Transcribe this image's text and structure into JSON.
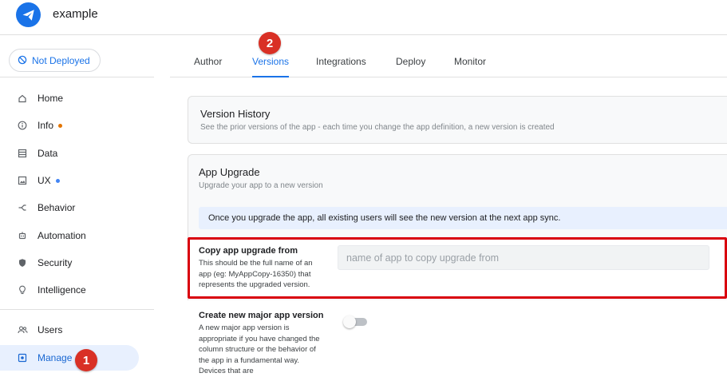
{
  "app": {
    "name": "example",
    "logo_icon": "paper-plane-icon",
    "brand_color": "#1a73e8"
  },
  "status": {
    "label": "Not Deployed",
    "icon": "not-deployed-icon"
  },
  "sidebar": {
    "items": [
      {
        "label": "Home",
        "icon": "home-icon"
      },
      {
        "label": "Info",
        "icon": "info-icon",
        "dot_color": "#e37400"
      },
      {
        "label": "Data",
        "icon": "data-icon"
      },
      {
        "label": "UX",
        "icon": "ux-icon",
        "dot_color": "#4285f4"
      },
      {
        "label": "Behavior",
        "icon": "behavior-icon"
      },
      {
        "label": "Automation",
        "icon": "automation-icon"
      },
      {
        "label": "Security",
        "icon": "shield-icon"
      },
      {
        "label": "Intelligence",
        "icon": "lightbulb-icon"
      }
    ],
    "secondary": [
      {
        "label": "Users",
        "icon": "users-icon"
      },
      {
        "label": "Manage",
        "icon": "manage-icon",
        "active": true
      }
    ]
  },
  "tabs": [
    {
      "label": "Author"
    },
    {
      "label": "Versions",
      "active": true
    },
    {
      "label": "Integrations"
    },
    {
      "label": "Deploy"
    },
    {
      "label": "Monitor"
    }
  ],
  "annotations": {
    "badge_1": "1",
    "badge_2": "2",
    "badge_color": "#d93025",
    "highlight_color": "#d9000d"
  },
  "version_history": {
    "title": "Version History",
    "subtitle": "See the prior versions of the app - each time you change the app definition, a new version is created"
  },
  "app_upgrade": {
    "title": "App Upgrade",
    "subtitle": "Upgrade your app to a new version",
    "banner": "Once you upgrade the app, all existing users will see the new version at the next app sync.",
    "copy_from": {
      "label": "Copy app upgrade from",
      "help": "This should be the full name of an app (eg: MyAppCopy-16350) that represents the upgraded version.",
      "value": "",
      "placeholder": "name of app to copy upgrade from"
    },
    "major_version": {
      "label": "Create new major app version",
      "help": "A new major app version is appropriate if you have changed the column structure or the behavior of the app in a fundamental way. Devices that are",
      "enabled": false
    }
  }
}
